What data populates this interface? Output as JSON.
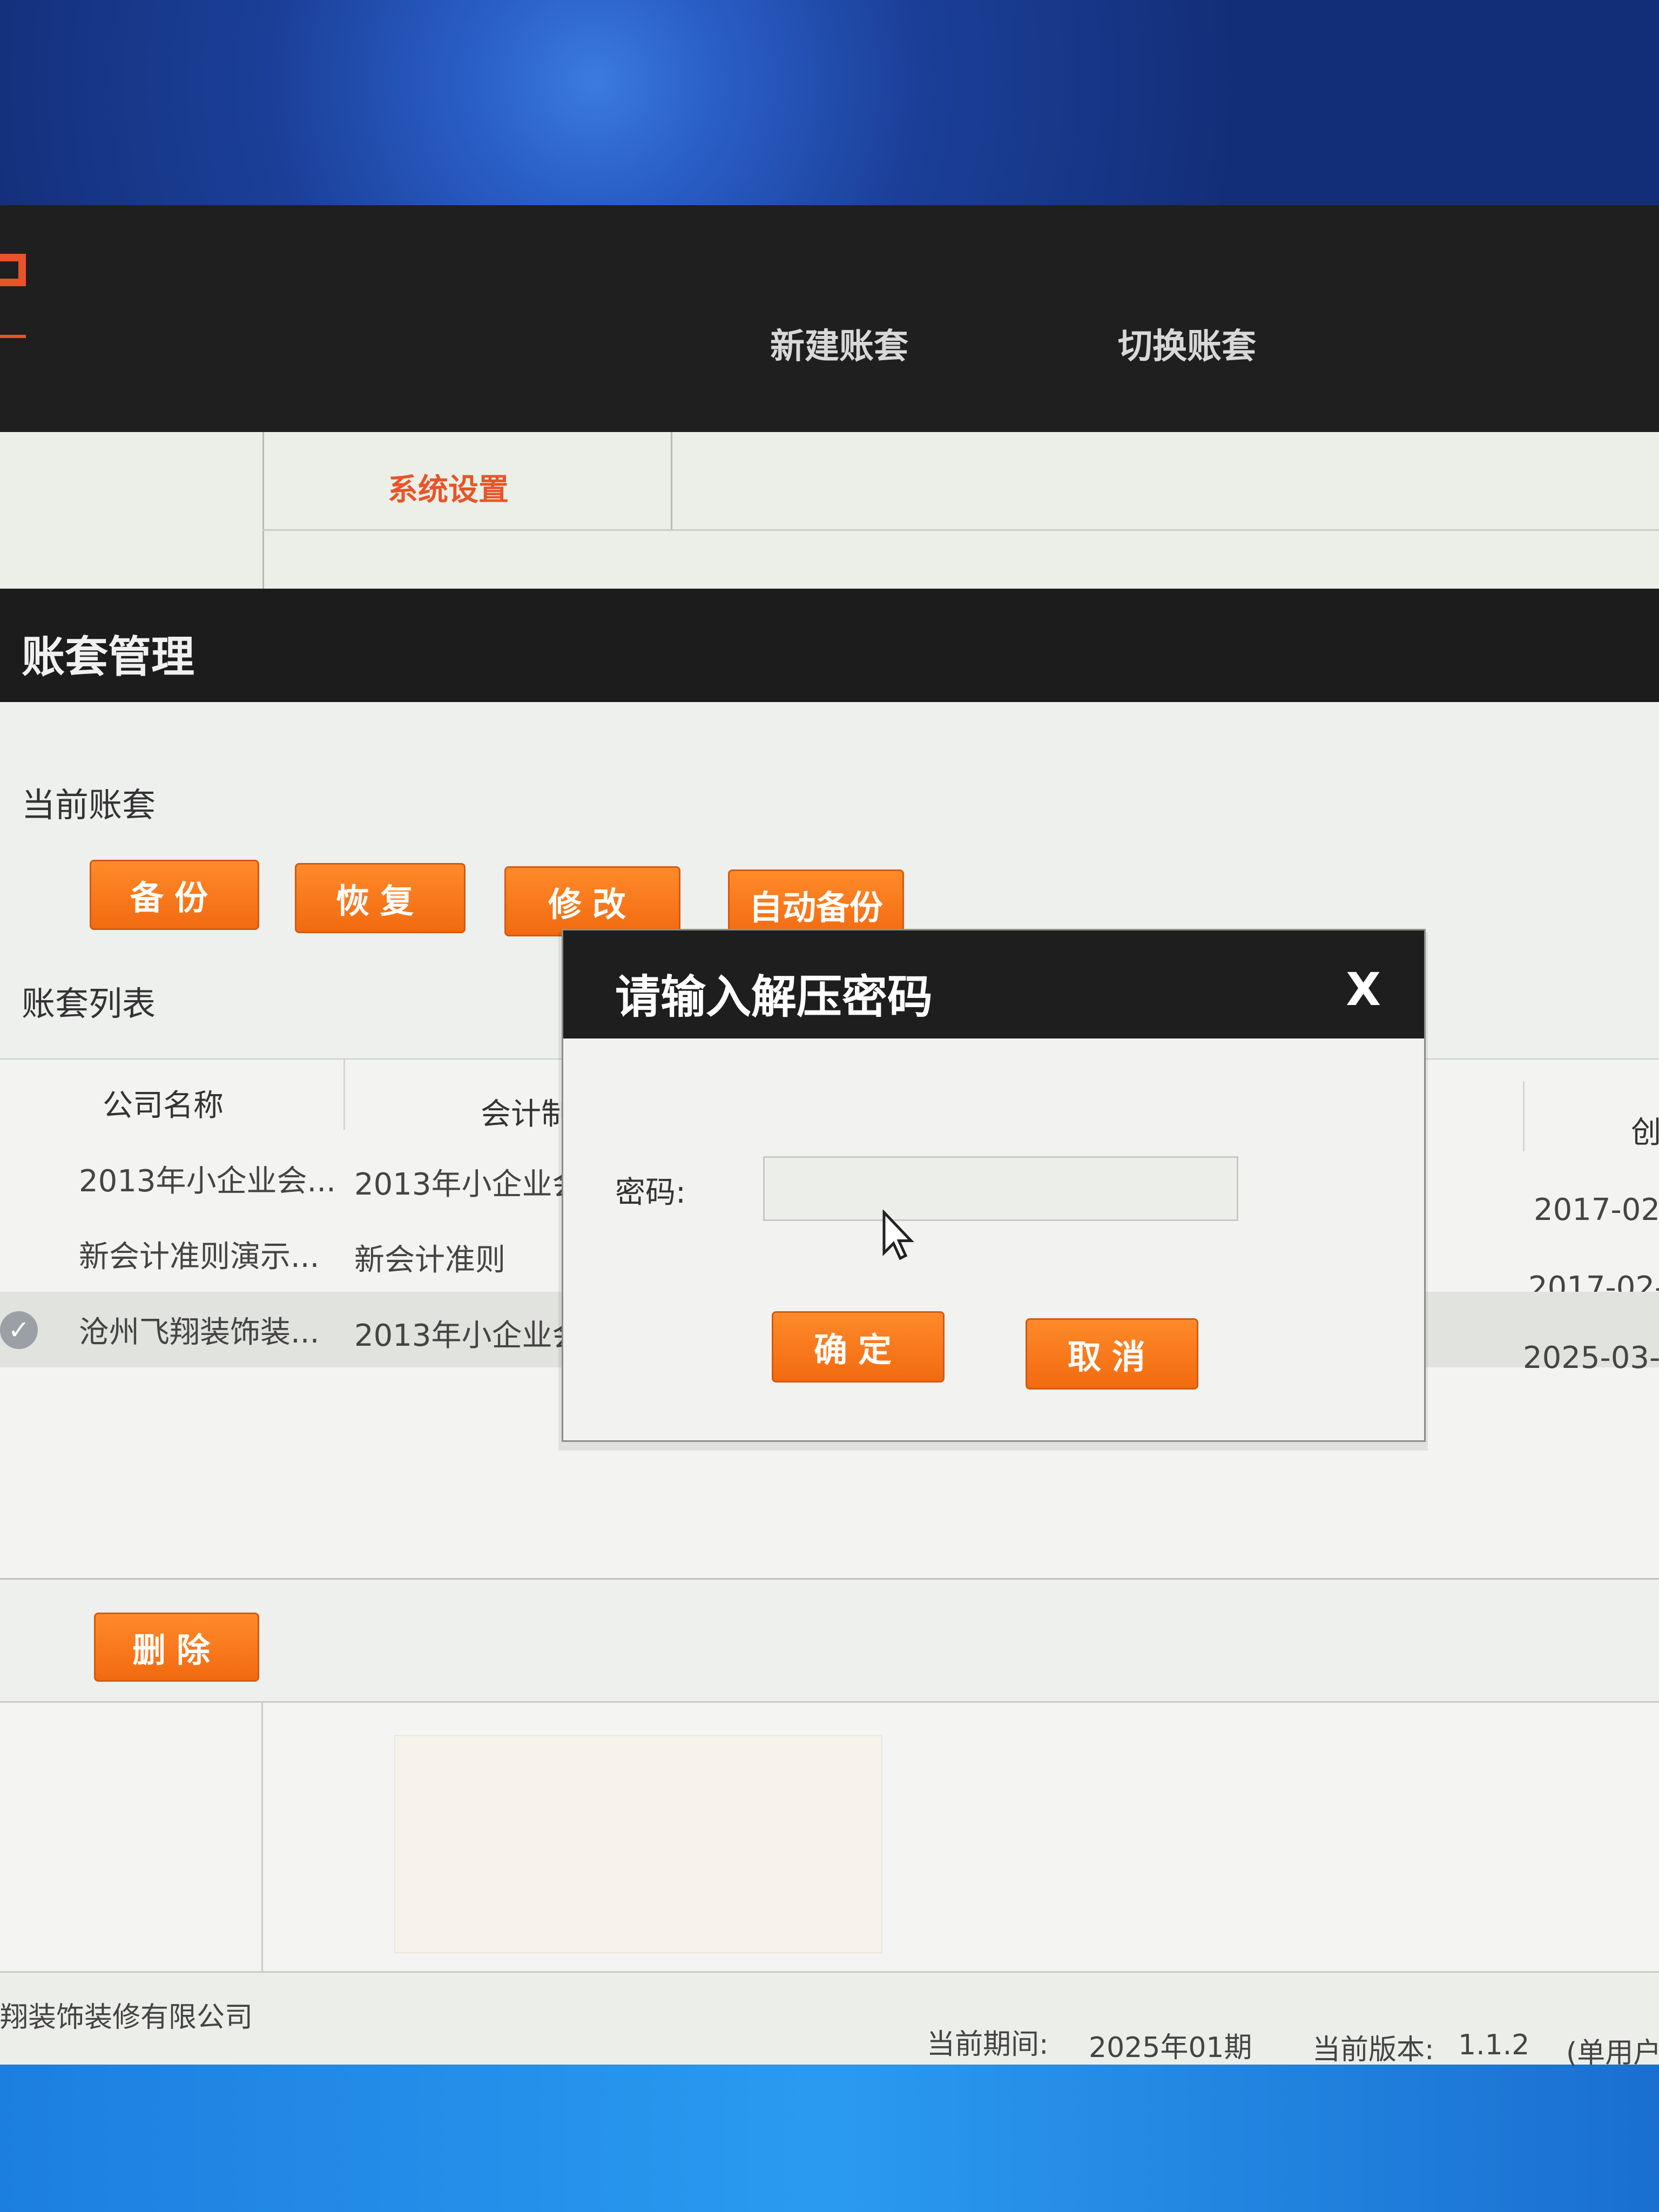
{
  "top_nav": {
    "new_account": "新建账套",
    "switch_account": "切换账套"
  },
  "sub_nav": {
    "system_settings": "系统设置"
  },
  "page_title": "账套管理",
  "current_account": {
    "label": "当前账套",
    "buttons": {
      "backup": "备份",
      "restore": "恢复",
      "modify": "修改",
      "auto_backup": "自动备份"
    }
  },
  "account_list": {
    "label": "账套列表",
    "columns": {
      "company_name": "公司名称",
      "accounting": "会计制",
      "created": "创"
    },
    "rows": [
      {
        "company": "2013年小企业会...",
        "standard": "2013年小企业会",
        "date": "2017-02"
      },
      {
        "company": "新会计准则演示...",
        "standard": "新会计准则",
        "date": "2017-02-"
      },
      {
        "company": "沧州飞翔装饰装...",
        "standard": "2013年小企业会",
        "date": "2025-03-",
        "selected": true
      }
    ],
    "delete_button": "删除"
  },
  "status_bar": {
    "company": "翔装饰装修有限公司",
    "period_label": "当前期间:",
    "period_value": "2025年01期",
    "version_label": "当前版本:",
    "version_value": "1.1.2",
    "mode": "(单用户"
  },
  "dialog": {
    "title": "请输入解压密码",
    "close": "X",
    "password_label": "密码:",
    "password_value": "",
    "ok": "确定",
    "cancel": "取消"
  },
  "colors": {
    "accent": "#f26a10",
    "header_dark": "#1e1e1e"
  }
}
